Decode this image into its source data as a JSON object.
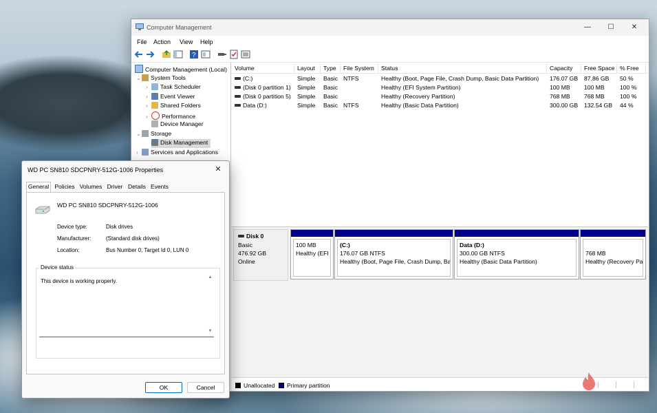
{
  "window": {
    "title": "Computer Management",
    "controls": {
      "minimize": "—",
      "maximize": "☐",
      "close": "✕"
    }
  },
  "menu": [
    "File",
    "Action",
    "View",
    "Help"
  ],
  "toolbar_icons": [
    "back-arrow-icon",
    "forward-arrow-icon",
    "up-folder-icon",
    "show-hide-tree-icon",
    "help-icon",
    "properties-icon",
    "connect-icon",
    "checklist-icon",
    "export-list-icon"
  ],
  "tree": {
    "root": "Computer Management (Local)",
    "system_tools": "System Tools",
    "task_scheduler": "Task Scheduler",
    "event_viewer": "Event Viewer",
    "shared_folders": "Shared Folders",
    "performance": "Performance",
    "device_manager": "Device Manager",
    "storage": "Storage",
    "disk_management": "Disk Management",
    "services": "Services and Applications"
  },
  "volumes": {
    "headers": {
      "volume": "Volume",
      "layout": "Layout",
      "type": "Type",
      "fs": "File System",
      "status": "Status",
      "capacity": "Capacity",
      "free": "Free Space",
      "pct": "% Free"
    },
    "rows": [
      {
        "volume": "(C:)",
        "layout": "Simple",
        "type": "Basic",
        "fs": "NTFS",
        "status": "Healthy (Boot, Page File, Crash Dump, Basic Data Partition)",
        "capacity": "176.07 GB",
        "free": "87.86 GB",
        "pct": "50 %"
      },
      {
        "volume": "(Disk 0 partition 1)",
        "layout": "Simple",
        "type": "Basic",
        "fs": "",
        "status": "Healthy (EFI System Partition)",
        "capacity": "100 MB",
        "free": "100 MB",
        "pct": "100 %"
      },
      {
        "volume": "(Disk 0 partition 5)",
        "layout": "Simple",
        "type": "Basic",
        "fs": "",
        "status": "Healthy (Recovery Partition)",
        "capacity": "768 MB",
        "free": "768 MB",
        "pct": "100 %"
      },
      {
        "volume": "Data (D:)",
        "layout": "Simple",
        "type": "Basic",
        "fs": "NTFS",
        "status": "Healthy (Basic Data Partition)",
        "capacity": "300.00 GB",
        "free": "132.54 GB",
        "pct": "44 %"
      }
    ]
  },
  "disk": {
    "name": "Disk 0",
    "type": "Basic",
    "size": "476.92 GB",
    "state": "Online",
    "partition_color": "#00008b",
    "partitions": [
      {
        "title": "",
        "line1": "100 MB",
        "line2": "Healthy (EFI System Partition)"
      },
      {
        "title": "(C:)",
        "line1": "176.07 GB NTFS",
        "line2": "Healthy (Boot, Page File, Crash Dump, Basic Data Partition)"
      },
      {
        "title": "Data  (D:)",
        "line1": "300.00 GB NTFS",
        "line2": "Healthy (Basic Data Partition)"
      },
      {
        "title": "",
        "line1": "768 MB",
        "line2": "Healthy (Recovery Partition)"
      }
    ]
  },
  "legend": {
    "unallocated": "Unallocated",
    "unallocated_color": "#000000",
    "primary": "Primary partition",
    "primary_color": "#00008b"
  },
  "dialog": {
    "title": "WD PC SN810 SDCPNRY-512G-1006 Properties",
    "close": "✕",
    "tabs": [
      "General",
      "Policies",
      "Volumes",
      "Driver",
      "Details",
      "Events"
    ],
    "device_name": "WD PC SN810 SDCPNRY-512G-1006",
    "props": [
      {
        "key": "Device type:",
        "value": "Disk drives"
      },
      {
        "key": "Manufacturer:",
        "value": "(Standard disk drives)"
      },
      {
        "key": "Location:",
        "value": "Bus Number 0, Target Id 0, LUN 0"
      }
    ],
    "status_label": "Device status",
    "status_text": "This device is working properly.",
    "ok": "OK",
    "cancel": "Cancel"
  }
}
